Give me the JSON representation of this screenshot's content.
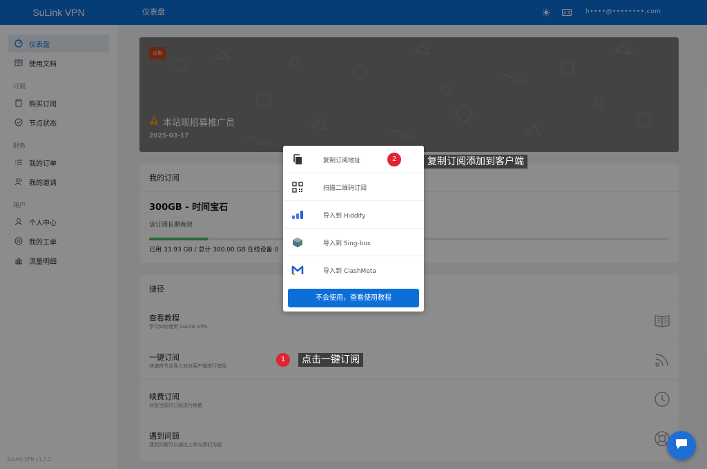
{
  "app": {
    "brand": "SuLink VPN",
    "version": "SuLink VPN v1.7.2"
  },
  "header": {
    "title": "仪表盘",
    "user_email": "h••••@••••••••.com"
  },
  "sidebar": {
    "items": [
      {
        "label": "仪表盘",
        "icon": "dashboard-icon",
        "active": true
      },
      {
        "label": "使用文档",
        "icon": "book-icon"
      }
    ],
    "sections": [
      {
        "title": "订阅",
        "items": [
          {
            "label": "购买订阅",
            "icon": "clipboard-icon"
          },
          {
            "label": "节点状态",
            "icon": "check-circle-icon"
          }
        ]
      },
      {
        "title": "财务",
        "items": [
          {
            "label": "我的订单",
            "icon": "list-icon"
          },
          {
            "label": "我的邀请",
            "icon": "users-icon"
          }
        ]
      },
      {
        "title": "用户",
        "items": [
          {
            "label": "个人中心",
            "icon": "user-icon"
          },
          {
            "label": "我的工单",
            "icon": "ticket-icon"
          },
          {
            "label": "流量明细",
            "icon": "bar-chart-icon"
          }
        ]
      }
    ]
  },
  "notice": {
    "tag": "公告",
    "title": "本站现招募推广员",
    "date": "2025-03-17"
  },
  "subscription": {
    "heading": "我的订阅",
    "plan": "300GB - 时间宝石",
    "desc": "该订阅长期有效",
    "usage_fraction": 0.113,
    "usage_text": "已用 33.93 GB / 总计 300.00 GB 在线设备 0"
  },
  "shortcuts": {
    "heading": "捷径",
    "items": [
      {
        "title": "查看教程",
        "sub": "学习如何使用 SuLink VPN",
        "icon": "book-open-icon"
      },
      {
        "title": "一键订阅",
        "sub": "快速将节点导入对应客户端进行使用",
        "icon": "rss-icon"
      },
      {
        "title": "续费订阅",
        "sub": "对您当前的订阅进行续费",
        "icon": "clock-icon"
      },
      {
        "title": "遇到问题",
        "sub": "遇到问题可以通过工单与我们沟通",
        "icon": "lifebuoy-icon"
      }
    ]
  },
  "popup": {
    "items": [
      {
        "label": "复制订阅地址",
        "icon": "copy-icon"
      },
      {
        "label": "扫描二维码订阅",
        "icon": "qrcode-icon"
      },
      {
        "label": "导入到 Hiddify",
        "icon": "hiddify-icon"
      },
      {
        "label": "导入到 Sing-box",
        "icon": "singbox-icon"
      },
      {
        "label": "导入到 ClashMeta",
        "icon": "clashmeta-icon"
      }
    ],
    "button": "不会使用，查看使用教程"
  },
  "annotations": [
    {
      "num": "1",
      "text": "点击一键订阅"
    },
    {
      "num": "2",
      "text": "复制订阅添加到客户端"
    }
  ],
  "colors": {
    "primary": "#0c6fd9",
    "badge": "#e02434",
    "tag": "#c94a1e",
    "progress": "#4bbf5e"
  }
}
